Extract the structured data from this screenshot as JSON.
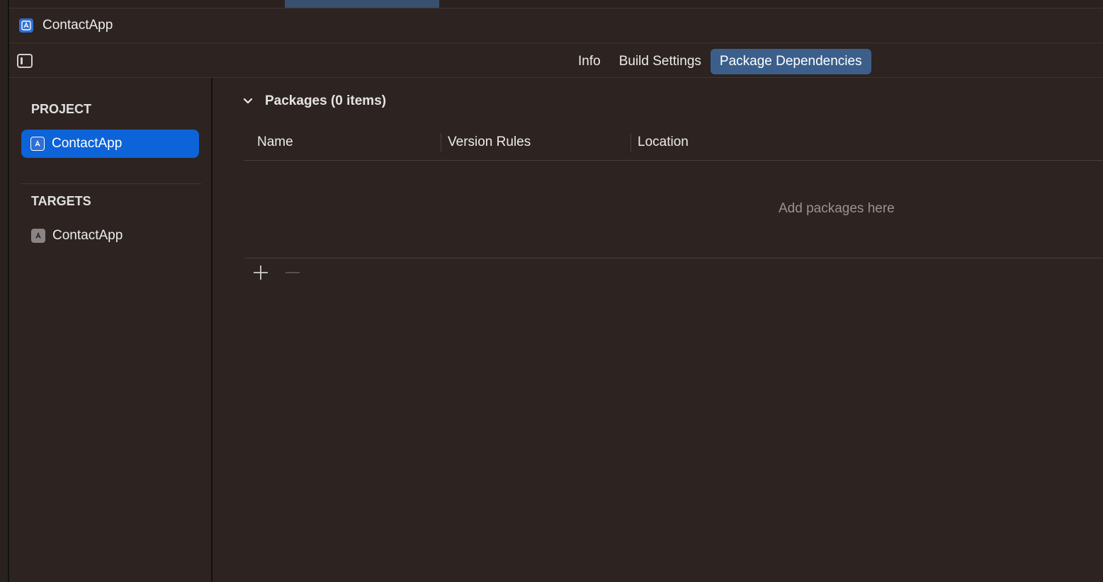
{
  "window": {
    "breadcrumb_title": "ContactApp"
  },
  "tabs": [
    {
      "label": "Info",
      "active": false
    },
    {
      "label": "Build Settings",
      "active": false
    },
    {
      "label": "Package Dependencies",
      "active": true
    }
  ],
  "sidebar": {
    "project_section": "PROJECT",
    "project_items": [
      {
        "label": "ContactApp",
        "icon": "app-project-icon",
        "selected": true
      }
    ],
    "targets_section": "TARGETS",
    "target_items": [
      {
        "label": "ContactApp",
        "icon": "app-target-icon",
        "selected": false
      }
    ]
  },
  "packages": {
    "section_title": "Packages (0 items)",
    "columns": [
      "Name",
      "Version Rules",
      "Location"
    ],
    "empty_message": "Add packages here",
    "add_icon": "plus-icon",
    "remove_icon": "minus-icon"
  },
  "colors": {
    "background": "#2d2320",
    "selection": "#0d63d8",
    "active_tab": "#3b5f8a",
    "project_icon": "#2f6fd6"
  }
}
